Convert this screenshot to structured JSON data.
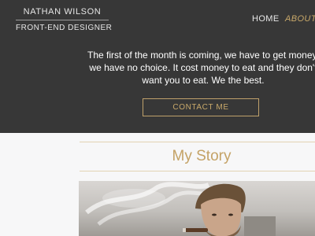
{
  "header": {
    "name": "NATHAN WILSON",
    "title": "FRONT-END DESIGNER"
  },
  "nav": {
    "items": [
      {
        "label": "HOME",
        "active": false
      },
      {
        "label": "ABOUT",
        "active": true
      }
    ]
  },
  "hero": {
    "tagline_lines": [
      "The first of the month is coming, we have to get money,",
      "we have no choice. It cost money to eat and they don't",
      "want you to eat. We the best."
    ],
    "cta_label": "CONTACT ME"
  },
  "section": {
    "title": "My Story"
  },
  "colors": {
    "hero_bg": "#373737",
    "accent_gold": "#c4a266",
    "page_bg": "#f7f7f8"
  }
}
